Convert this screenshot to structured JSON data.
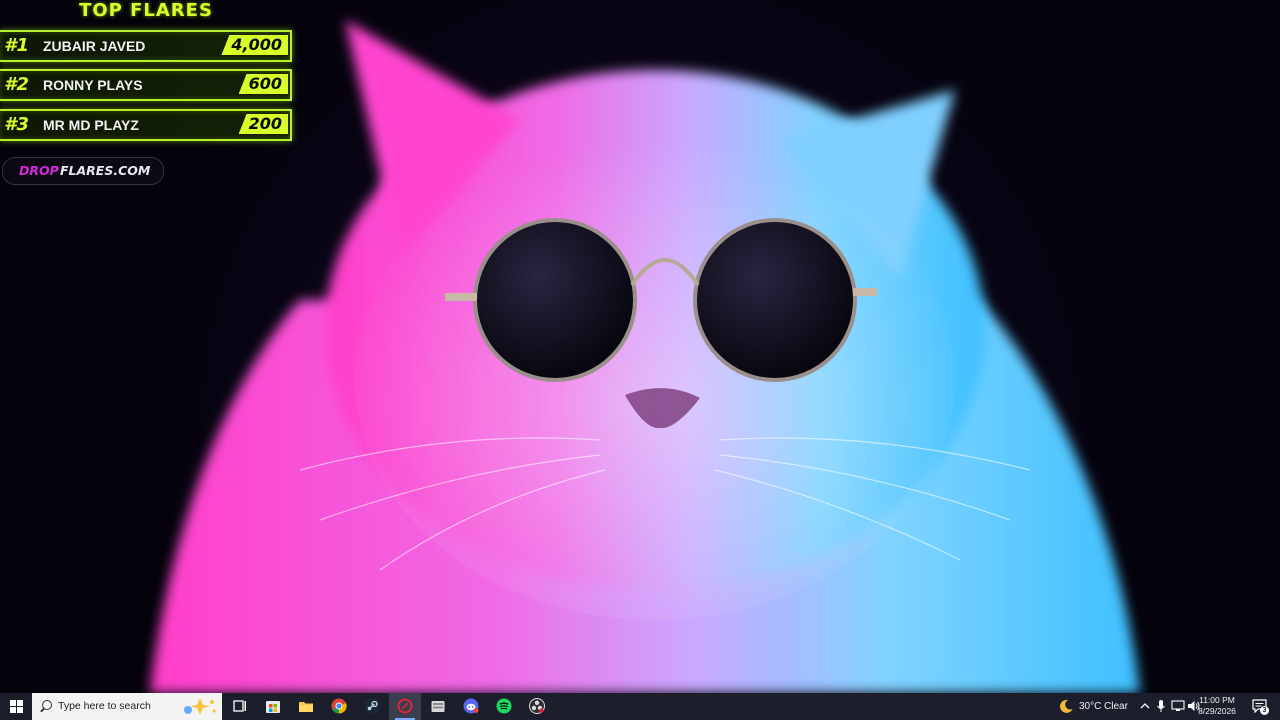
{
  "overlay": {
    "title": "TOP FLARES",
    "leaders": [
      {
        "rank": "#1",
        "name": "ZUBAIR JAVED",
        "amount": "4,000"
      },
      {
        "rank": "#2",
        "name": "RONNY PLAYS",
        "amount": "600"
      },
      {
        "rank": "#3",
        "name": "MR MD PLAYZ",
        "amount": "200"
      }
    ],
    "site": {
      "part1": "DROP",
      "part2": "FLARES.COM"
    },
    "colors": {
      "accent": "#d7ff2a",
      "site_accent": "#d12bd8"
    }
  },
  "taskbar": {
    "search_placeholder": "Type here to search",
    "apps": [
      "task-view",
      "microsoft-store",
      "file-explorer",
      "chrome",
      "steam",
      "app-red-circle",
      "file-manager",
      "discord",
      "spotify",
      "obs"
    ],
    "weather": {
      "temp": "30°C",
      "condition": "Clear"
    },
    "clock": {
      "time": "11:00 PM",
      "date": "8/29/2026"
    },
    "notification_count": "3"
  }
}
